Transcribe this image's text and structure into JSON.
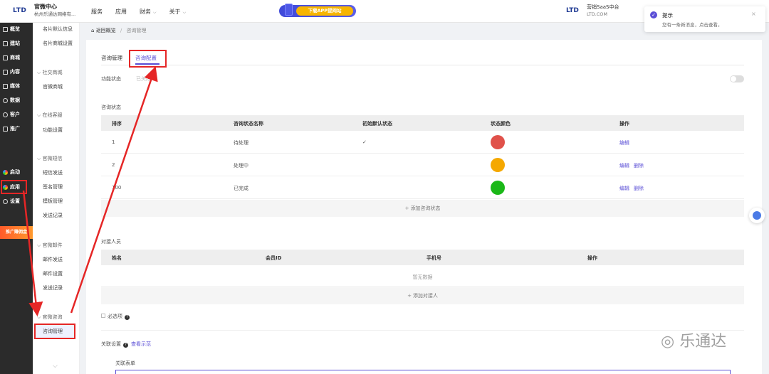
{
  "topbar": {
    "logo": "LTD",
    "brand_title": "官微中心",
    "brand_subtitle": "杭州乐通达网络有...",
    "nav": [
      "服务",
      "应用",
      "财务",
      "关于"
    ],
    "download_label": "下载APP提网站",
    "saas_logo": "LTD",
    "saas_title": "营销SaaS中台",
    "saas_domain": "LTD.COM"
  },
  "toast": {
    "title": "提示",
    "message": "您有一条新消息，点击查看。"
  },
  "sidebar": {
    "items": [
      {
        "label": "概览",
        "icon": "overview-icon"
      },
      {
        "label": "建站",
        "icon": "home-icon"
      },
      {
        "label": "商城",
        "icon": "shop-icon"
      },
      {
        "label": "内容",
        "icon": "document-icon"
      },
      {
        "label": "媒体",
        "icon": "media-icon"
      },
      {
        "label": "数据",
        "icon": "clock-icon"
      },
      {
        "label": "客户",
        "icon": "user-icon"
      },
      {
        "label": "推广",
        "icon": "promote-icon"
      }
    ],
    "bottom_items": [
      {
        "label": "启动",
        "icon": "launch-icon"
      },
      {
        "label": "应用",
        "icon": "apps-icon"
      },
      {
        "label": "设置",
        "icon": "gear-icon"
      }
    ],
    "promo": "推广赚佣金"
  },
  "subnav": {
    "items_top": [
      "名片默认信息",
      "名片商城设置"
    ],
    "groups": [
      {
        "title": "社交商城",
        "items": [
          "官微商城"
        ]
      },
      {
        "title": "在线客服",
        "items": [
          "功能设置"
        ]
      },
      {
        "title": "官微短信",
        "items": [
          "短信发送",
          "签名管理",
          "模板管理",
          "发送记录"
        ]
      },
      {
        "title": "官微邮件",
        "items": [
          "邮件发送",
          "邮件设置",
          "发送记录"
        ]
      },
      {
        "title": "官微咨询",
        "items": [
          "咨询管理"
        ]
      }
    ]
  },
  "breadcrumb": {
    "back": "返回概览",
    "current": "咨询管理"
  },
  "tabs": [
    "咨询管理",
    "咨询配置"
  ],
  "function_status": {
    "label": "功能状态",
    "value": "已关闭"
  },
  "consult_status": {
    "section_title": "咨询状态",
    "headers": [
      "排序",
      "咨询状态名称",
      "初始默认状态",
      "状态颜色",
      "操作"
    ],
    "rows": [
      {
        "order": "1",
        "name": "待处理",
        "default": "✓",
        "color": "#e0514a",
        "actions": [
          "编辑"
        ]
      },
      {
        "order": "2",
        "name": "处理中",
        "default": "",
        "color": "#f5a800",
        "actions": [
          "编辑",
          "删除"
        ]
      },
      {
        "order": "100",
        "name": "已完成",
        "default": "",
        "color": "#1bb818",
        "actions": [
          "编辑",
          "删除"
        ]
      }
    ],
    "add_label": "添加咨询状态"
  },
  "contacts": {
    "section_title": "对接人员",
    "headers": [
      "姓名",
      "会员ID",
      "手机号",
      "操作"
    ],
    "empty": "暂无数据",
    "add_label": "添加对接人"
  },
  "required_label": "必选项",
  "related": {
    "label": "关联设置",
    "example": "查看示范",
    "form_label": "关联表单"
  },
  "watermark": "乐通达"
}
